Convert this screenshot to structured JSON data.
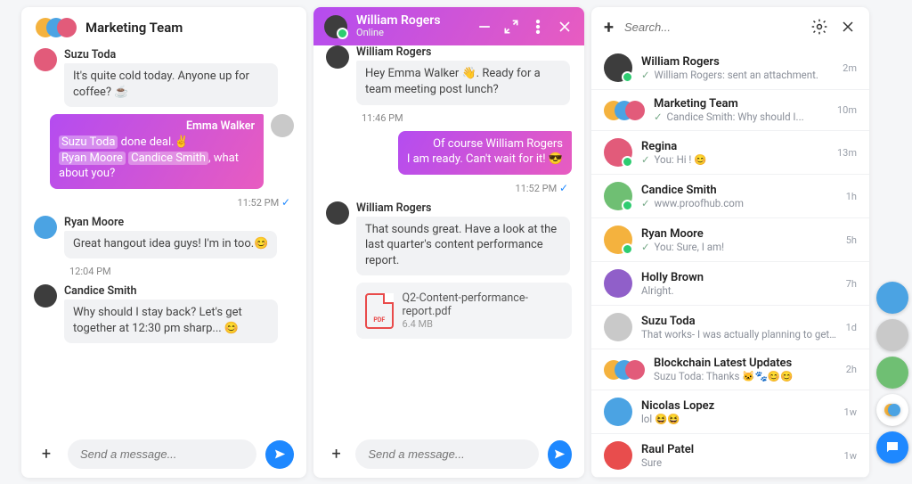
{
  "panel1": {
    "title": "Marketing Team",
    "messages": [
      {
        "sender": "Suzu Toda",
        "text": "It's quite cold today. Anyone up for coffee? ☕"
      },
      {
        "sender": "Emma Walker",
        "parts": [
          "Suzu Toda",
          " done deal.✌️",
          "Ryan Moore",
          " ",
          "Candice Smith",
          ", what about you?"
        ],
        "time": "11:52 PM"
      },
      {
        "sender": "Ryan Moore",
        "text": "Great hangout idea guys! I'm in too.😊",
        "time": "12:04 PM"
      },
      {
        "sender": "Candice Smith",
        "text": "Why should I stay back? Let's get together at 12:30 pm sharp... 😊"
      }
    ],
    "composer_placeholder": "Send a message..."
  },
  "panel2": {
    "title": "William Rogers",
    "status": "Online",
    "messages": [
      {
        "sender": "William Rogers",
        "text": "Hey Emma Walker 👋. Ready for a team meeting post lunch?",
        "time": "11:46 PM"
      },
      {
        "text_top": "Of course William Rogers",
        "text_bottom": "I am ready. Can't wait for it! 😎",
        "time": "11:52 PM"
      },
      {
        "sender": "William Rogers",
        "text": "That sounds great. Have a look at the last quarter's content performance report.",
        "attachment": {
          "name": "Q2-Content-performance-report.pdf",
          "size": "6.4 MB"
        }
      }
    ],
    "composer_placeholder": "Send a message..."
  },
  "panel3": {
    "search_placeholder": "Search...",
    "items": [
      {
        "name": "William Rogers",
        "preview": "William Rogers: sent an attachment.",
        "time": "2m",
        "tick": true,
        "presence": true
      },
      {
        "name": "Marketing Team",
        "preview": "Candice Smith: Why should I...",
        "time": "10m",
        "tick": true,
        "group": true
      },
      {
        "name": "Regina",
        "preview": "You: Hi ! 😊",
        "time": "13m",
        "tick": true,
        "presence": true
      },
      {
        "name": "Candice Smith",
        "preview": "www.proofhub.com",
        "time": "1h",
        "tick": true,
        "presence": true
      },
      {
        "name": "Ryan Moore",
        "preview": "You: Sure, I am!",
        "time": "5h",
        "tick": true,
        "presence": true
      },
      {
        "name": "Holly Brown",
        "preview": "Alright.",
        "time": "7h"
      },
      {
        "name": "Suzu Toda",
        "preview": "That works- I was actually planning to get...",
        "time": "1d"
      },
      {
        "name": "Blockchain Latest Updates",
        "preview": "Suzu Toda: Thanks 🐱🐾😊😊",
        "time": "2h",
        "group": true
      },
      {
        "name": "Nicolas Lopez",
        "preview": "lol 😆😆",
        "time": "1w"
      },
      {
        "name": "Raul Patel",
        "preview": "Sure",
        "time": "1w"
      }
    ]
  },
  "avatar_colors": [
    "c8",
    "c4",
    "c2",
    "c3",
    "c1",
    "c5",
    "c7",
    "c6",
    "c4",
    "c6",
    "c7"
  ]
}
